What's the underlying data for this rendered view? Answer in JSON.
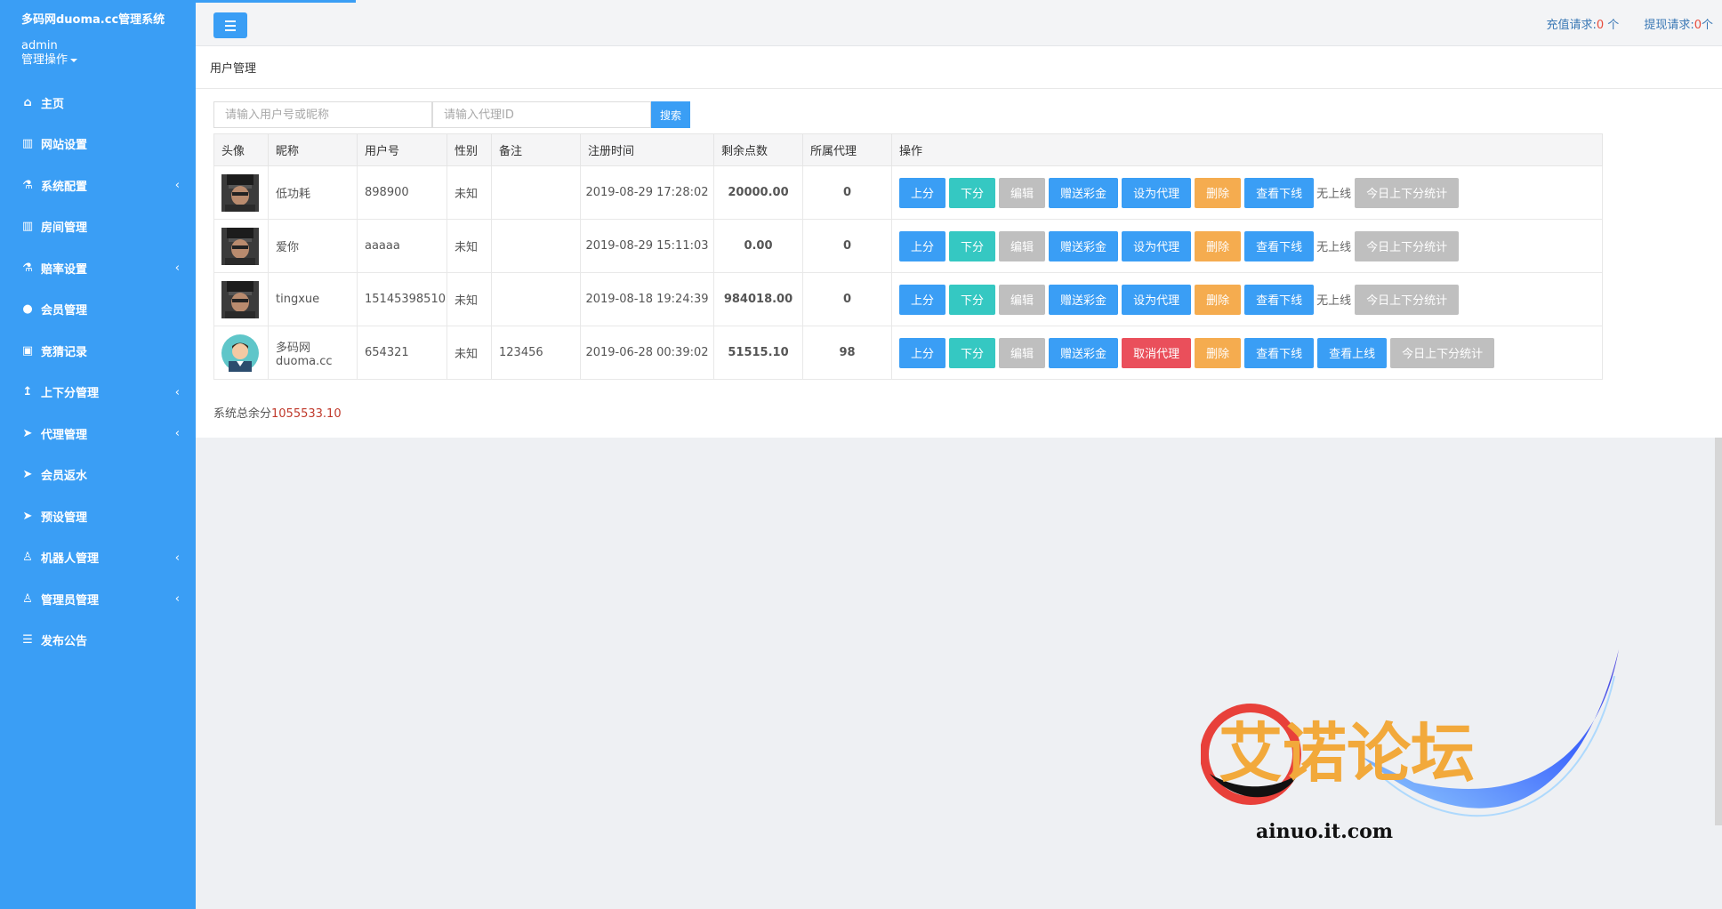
{
  "sidebar": {
    "title": "多码网duoma.cc管理系统",
    "user": "admin",
    "ops_label": "管理操作",
    "items": [
      {
        "label": "主页",
        "icon": "home-icon",
        "has_sub": false
      },
      {
        "label": "网站设置",
        "icon": "columns-icon",
        "has_sub": false
      },
      {
        "label": "系统配置",
        "icon": "flask-icon",
        "has_sub": true
      },
      {
        "label": "房间管理",
        "icon": "columns-icon",
        "has_sub": false
      },
      {
        "label": "赔率设置",
        "icon": "flask-icon",
        "has_sub": true
      },
      {
        "label": "会员管理",
        "icon": "user-icon",
        "has_sub": false
      },
      {
        "label": "竞猜记录",
        "icon": "car-icon",
        "has_sub": false
      },
      {
        "label": "上下分管理",
        "icon": "level-up-icon",
        "has_sub": true
      },
      {
        "label": "代理管理",
        "icon": "paper-plane-icon",
        "has_sub": true
      },
      {
        "label": "会员返水",
        "icon": "paper-plane-icon",
        "has_sub": false
      },
      {
        "label": "预设管理",
        "icon": "paper-plane-icon",
        "has_sub": false
      },
      {
        "label": "机器人管理",
        "icon": "male-icon",
        "has_sub": true
      },
      {
        "label": "管理员管理",
        "icon": "male-icon",
        "has_sub": true
      },
      {
        "label": "发布公告",
        "icon": "comments-icon",
        "has_sub": false
      }
    ]
  },
  "topbar": {
    "recharge_label": "充值请求:",
    "recharge_count": "0",
    "recharge_unit": " 个",
    "withdraw_label": "提现请求:",
    "withdraw_count": "0",
    "withdraw_unit": "个"
  },
  "page": {
    "title": "用户管理",
    "search_placeholder_user": "请输入用户号或昵称",
    "search_placeholder_agent": "请输入代理ID",
    "search_button": "搜索"
  },
  "table": {
    "headers": [
      "头像",
      "昵称",
      "用户号",
      "性别",
      "备注",
      "注册时间",
      "剩余点数",
      "所属代理",
      "操作"
    ],
    "rows": [
      {
        "nickname": "低功耗",
        "user_id": "898900",
        "gender": "未知",
        "note": "",
        "reg_time": "2019-08-29 17:28:02",
        "points": "20000.00",
        "agent": "0",
        "avatar": "soldier",
        "ops": {
          "up": "上分",
          "down": "下分",
          "edit": "编辑",
          "gift": "赠送彩金",
          "agent_toggle": "设为代理",
          "delete": "删除",
          "view_down": "查看下线",
          "no_upline": "无上线",
          "stats": "今日上下分统计"
        }
      },
      {
        "nickname": "爱你",
        "user_id": "aaaaa",
        "gender": "未知",
        "note": "",
        "reg_time": "2019-08-29 15:11:03",
        "points": "0.00",
        "agent": "0",
        "avatar": "soldier",
        "ops": {
          "up": "上分",
          "down": "下分",
          "edit": "编辑",
          "gift": "赠送彩金",
          "agent_toggle": "设为代理",
          "delete": "删除",
          "view_down": "查看下线",
          "no_upline": "无上线",
          "stats": "今日上下分统计"
        }
      },
      {
        "nickname": "tingxue",
        "user_id": "15145398510",
        "gender": "未知",
        "note": "",
        "reg_time": "2019-08-18 19:24:39",
        "points": "984018.00",
        "agent": "0",
        "avatar": "soldier",
        "ops": {
          "up": "上分",
          "down": "下分",
          "edit": "编辑",
          "gift": "赠送彩金",
          "agent_toggle": "设为代理",
          "delete": "删除",
          "view_down": "查看下线",
          "no_upline": "无上线",
          "stats": "今日上下分统计"
        }
      },
      {
        "nickname": "多码网\nduoma.cc",
        "user_id": "654321",
        "gender": "未知",
        "note": "123456",
        "reg_time": "2019-06-28 00:39:02",
        "points": "51515.10",
        "agent": "98",
        "avatar": "cartoon",
        "ops": {
          "up": "上分",
          "down": "下分",
          "edit": "编辑",
          "gift": "赠送彩金",
          "agent_toggle": "取消代理",
          "delete": "删除",
          "view_down": "查看下线",
          "view_up": "查看上线",
          "stats": "今日上下分统计"
        }
      }
    ]
  },
  "total": {
    "label": "系统总余分",
    "value": "1055533.10"
  },
  "watermark": {
    "title": "艾诺论坛",
    "url": "ainuo.it.com"
  },
  "colors": {
    "sidebar": "#3a9ef5",
    "blue": "#3a9ef5",
    "teal": "#35c8c2",
    "gray": "#bfbfbf",
    "orange": "#f5ac4f",
    "red": "#ea4f5b"
  }
}
